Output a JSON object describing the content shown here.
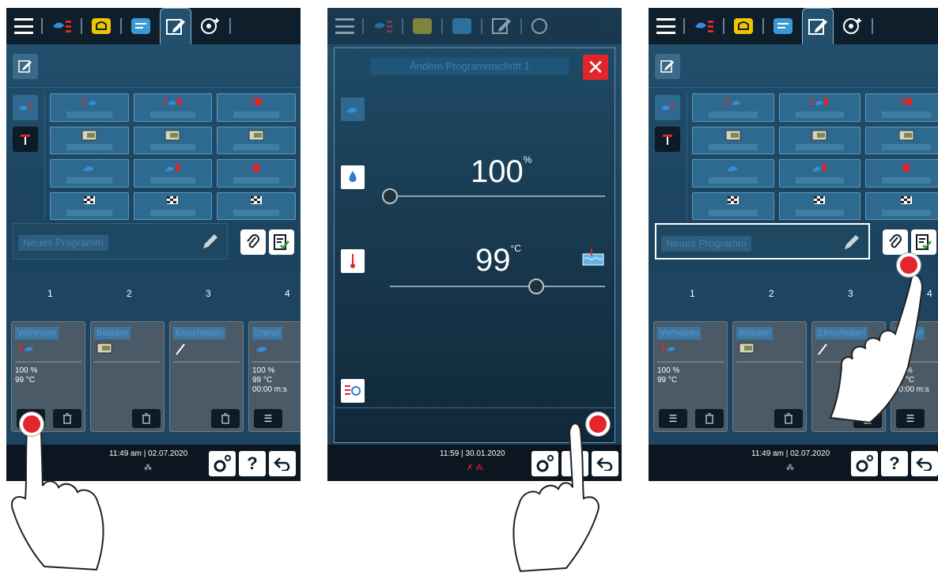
{
  "screens": [
    {
      "program_name_placeholder": "Neues Programm",
      "steps": [
        {
          "number": "1",
          "title": "Vorheizen",
          "values": "100 %\n99 °C"
        },
        {
          "number": "2",
          "title": "Beladen",
          "values": ""
        },
        {
          "number": "3",
          "title": "Einschieben",
          "values": ""
        },
        {
          "number": "4",
          "title": "Dampf",
          "values": "100 %\n99 °C\n00:00 m:s"
        }
      ],
      "time": "11:49 am | 02.07.2020"
    },
    {
      "dialog_title": "Ändern Programmschritt 1",
      "humidity_value": "100",
      "humidity_unit": "%",
      "humidity_level": 0.0,
      "temperature_value": "99",
      "temperature_unit": "°C",
      "temperature_level": 0.68,
      "time": "11:59 | 30.01.2020"
    },
    {
      "program_name_placeholder": "Neues Programm",
      "steps": [
        {
          "number": "1",
          "title": "Vorheizen",
          "values": "100 %\n99 °C"
        },
        {
          "number": "2",
          "title": "Beladen",
          "values": ""
        },
        {
          "number": "3",
          "title": "Einschieben",
          "values": ""
        },
        {
          "number": "4",
          "title": "Dampf",
          "values": "00 %\n99 °C\n00:00 m:s"
        }
      ],
      "time": "11:49 am | 02.07.2020"
    }
  ],
  "help_label": "?",
  "colors": {
    "touch_point": "#e3252c",
    "close_button": "#e0252b",
    "screen_bg": "#1d4561"
  }
}
